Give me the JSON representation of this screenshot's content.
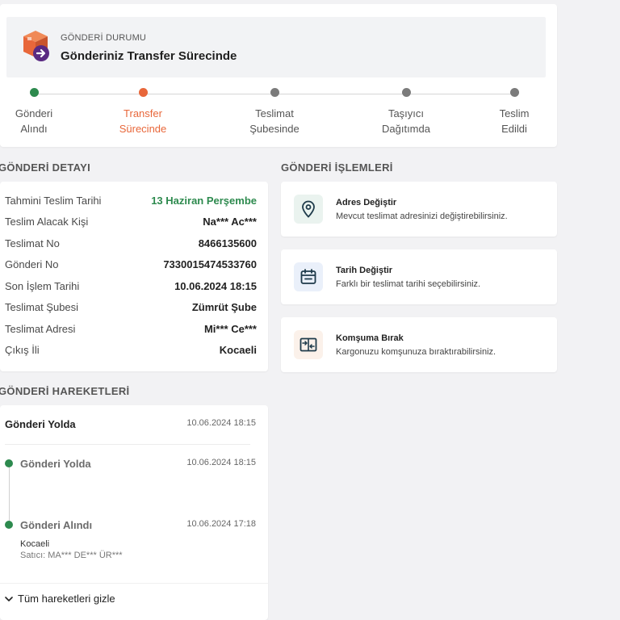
{
  "status": {
    "caption": "GÖNDERİ DURUMU",
    "heading": "Gönderiniz Transfer Sürecinde",
    "logo_icon": "box-arrow-icon"
  },
  "steps": [
    {
      "line1": "Gönderi",
      "line2": "Alındı",
      "state": "done"
    },
    {
      "line1": "Transfer",
      "line2": "Sürecinde",
      "state": "active"
    },
    {
      "line1": "Teslimat",
      "line2": "Şubesinde",
      "state": "pending"
    },
    {
      "line1": "Taşıyıcı",
      "line2": "Dağıtımda",
      "state": "pending"
    },
    {
      "line1": "Teslim",
      "line2": "Edildi",
      "state": "pending"
    }
  ],
  "detail": {
    "title": "GÖNDERİ DETAYI",
    "rows": [
      {
        "key": "Tahmini Teslim Tarihi",
        "value": "13 Haziran Perşembe"
      },
      {
        "key": "Teslim Alacak Kişi",
        "value": "Na*** Ac***"
      },
      {
        "key": "Teslimat No",
        "value": "8466135600"
      },
      {
        "key": "Gönderi No",
        "value": "7330015474533760"
      },
      {
        "key": "Son İşlem Tarihi",
        "value": "10.06.2024 18:15"
      },
      {
        "key": "Teslimat Şubesi",
        "value": "Zümrüt Şube"
      },
      {
        "key": "Teslimat Adresi",
        "value": "Mi*** Ce***"
      },
      {
        "key": "Çıkış İli",
        "value": "Kocaeli"
      }
    ]
  },
  "actions": {
    "title": "GÖNDERİ İŞLEMLERİ",
    "items": [
      {
        "title": "Adres Değiştir",
        "desc": "Mevcut teslimat adresinizi değiştirebilirsiniz.",
        "icon": "location-pin-icon"
      },
      {
        "title": "Tarih Değiştir",
        "desc": "Farklı bir teslimat tarihi seçebilirsiniz.",
        "icon": "calendar-icon"
      },
      {
        "title": "Komşuma Bırak",
        "desc": "Kargonuzu komşunuza bıraktırabilirsiniz.",
        "icon": "neighbor-swap-icon"
      }
    ]
  },
  "moves": {
    "title": "GÖNDERİ HAREKETLERİ",
    "head": {
      "title": "Gönderi Yolda",
      "time": "10.06.2024 18:15"
    },
    "items": [
      {
        "title": "Gönderi Yolda",
        "time": "10.06.2024 18:15"
      },
      {
        "title": "Gönderi Alındı",
        "time": "10.06.2024 17:18",
        "location": "Kocaeli",
        "seller": "Satıcı: MA*** DE*** ÜR***"
      }
    ],
    "toggle": "Tüm hareketleri gizle"
  },
  "colors": {
    "done": "#2d8a4e",
    "active": "#e8673a",
    "pending": "#7b7b7b",
    "logo_orange": "#e8673a",
    "logo_purple": "#5a2a82"
  }
}
